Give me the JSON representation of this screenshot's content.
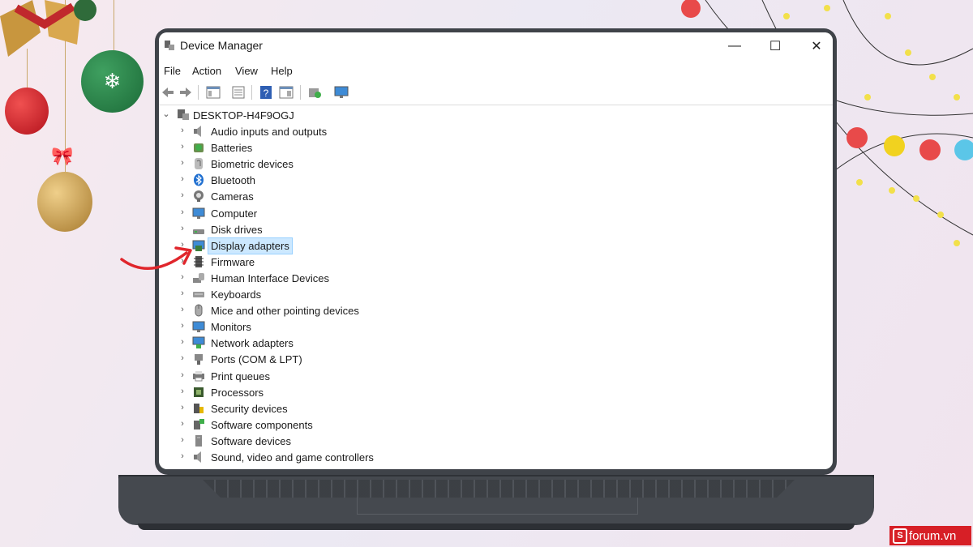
{
  "window": {
    "title": "Device Manager",
    "minimize_glyph": "—",
    "maximize_glyph": "☐",
    "close_glyph": "✕"
  },
  "menu": [
    "File",
    "Action",
    "View",
    "Help"
  ],
  "toolbar_icons": [
    "back-icon",
    "forward-icon",
    "show-hide-console-tree-icon",
    "properties-icon",
    "help-icon",
    "action-pane-icon",
    "scan-hardware-icon",
    "monitor-icon"
  ],
  "tree": {
    "root": "DESKTOP-H4F9OGJ",
    "selected": "Display adapters",
    "items": [
      {
        "label": "Audio inputs and outputs",
        "icon": "speaker-icon"
      },
      {
        "label": "Batteries",
        "icon": "battery-icon"
      },
      {
        "label": "Biometric devices",
        "icon": "fingerprint-icon"
      },
      {
        "label": "Bluetooth",
        "icon": "bluetooth-icon"
      },
      {
        "label": "Cameras",
        "icon": "camera-icon"
      },
      {
        "label": "Computer",
        "icon": "computer-icon"
      },
      {
        "label": "Disk drives",
        "icon": "disk-drive-icon"
      },
      {
        "label": "Display adapters",
        "icon": "display-adapter-icon"
      },
      {
        "label": "Firmware",
        "icon": "firmware-icon"
      },
      {
        "label": "Human Interface Devices",
        "icon": "hid-icon"
      },
      {
        "label": "Keyboards",
        "icon": "keyboard-icon"
      },
      {
        "label": "Mice and other pointing devices",
        "icon": "mouse-icon"
      },
      {
        "label": "Monitors",
        "icon": "monitor-icon"
      },
      {
        "label": "Network adapters",
        "icon": "network-icon"
      },
      {
        "label": "Ports (COM & LPT)",
        "icon": "port-icon"
      },
      {
        "label": "Print queues",
        "icon": "printer-icon"
      },
      {
        "label": "Processors",
        "icon": "processor-icon"
      },
      {
        "label": "Security devices",
        "icon": "security-icon"
      },
      {
        "label": "Software components",
        "icon": "software-component-icon"
      },
      {
        "label": "Software devices",
        "icon": "software-device-icon"
      },
      {
        "label": "Sound, video and game controllers",
        "icon": "sound-icon"
      }
    ]
  },
  "watermark": {
    "badge": "S",
    "text": "forum.vn"
  },
  "colors": {
    "accent": "#d71f26",
    "selection": "#cce8ff",
    "laptop": "#3f4349"
  }
}
